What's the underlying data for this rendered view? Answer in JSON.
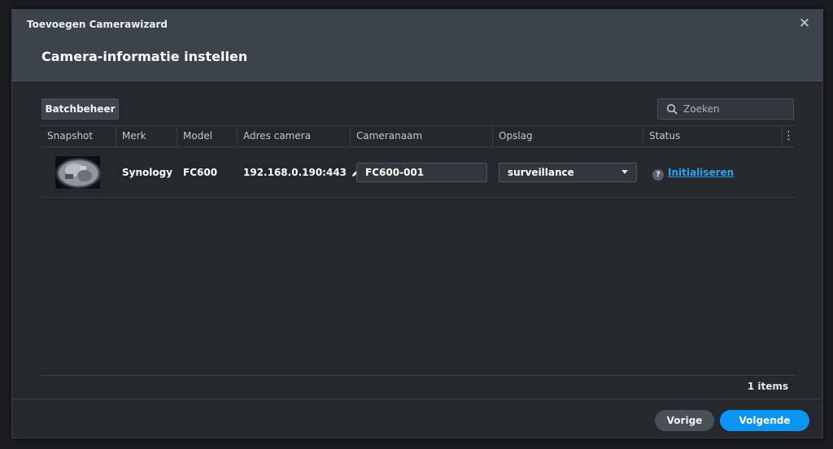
{
  "dialog": {
    "wizard_title": "Toevoegen Camerawizard",
    "step_title": "Camera-informatie instellen"
  },
  "toolbar": {
    "batch_label": "Batchbeheer",
    "search_placeholder": "Zoeken"
  },
  "table": {
    "columns": [
      "Snapshot",
      "Merk",
      "Model",
      "Adres camera",
      "Cameranaam",
      "Opslag",
      "Status"
    ],
    "rows": [
      {
        "brand": "Synology",
        "model": "FC600",
        "address": "192.168.0.190:443",
        "camera_name": "FC600-001",
        "storage": "surveillance",
        "status": "Initialiseren"
      }
    ]
  },
  "footer": {
    "count": "1 items",
    "prev_label": "Vorige",
    "next_label": "Volgende"
  },
  "colors": {
    "accent": "#0a95f3",
    "link": "#2aa4f4",
    "header_bg": "#3d434b",
    "body_bg": "#25282c"
  },
  "icons": [
    "close-icon",
    "search-icon",
    "edit-icon",
    "help-icon",
    "caret-down-icon",
    "more-vertical-icon"
  ]
}
